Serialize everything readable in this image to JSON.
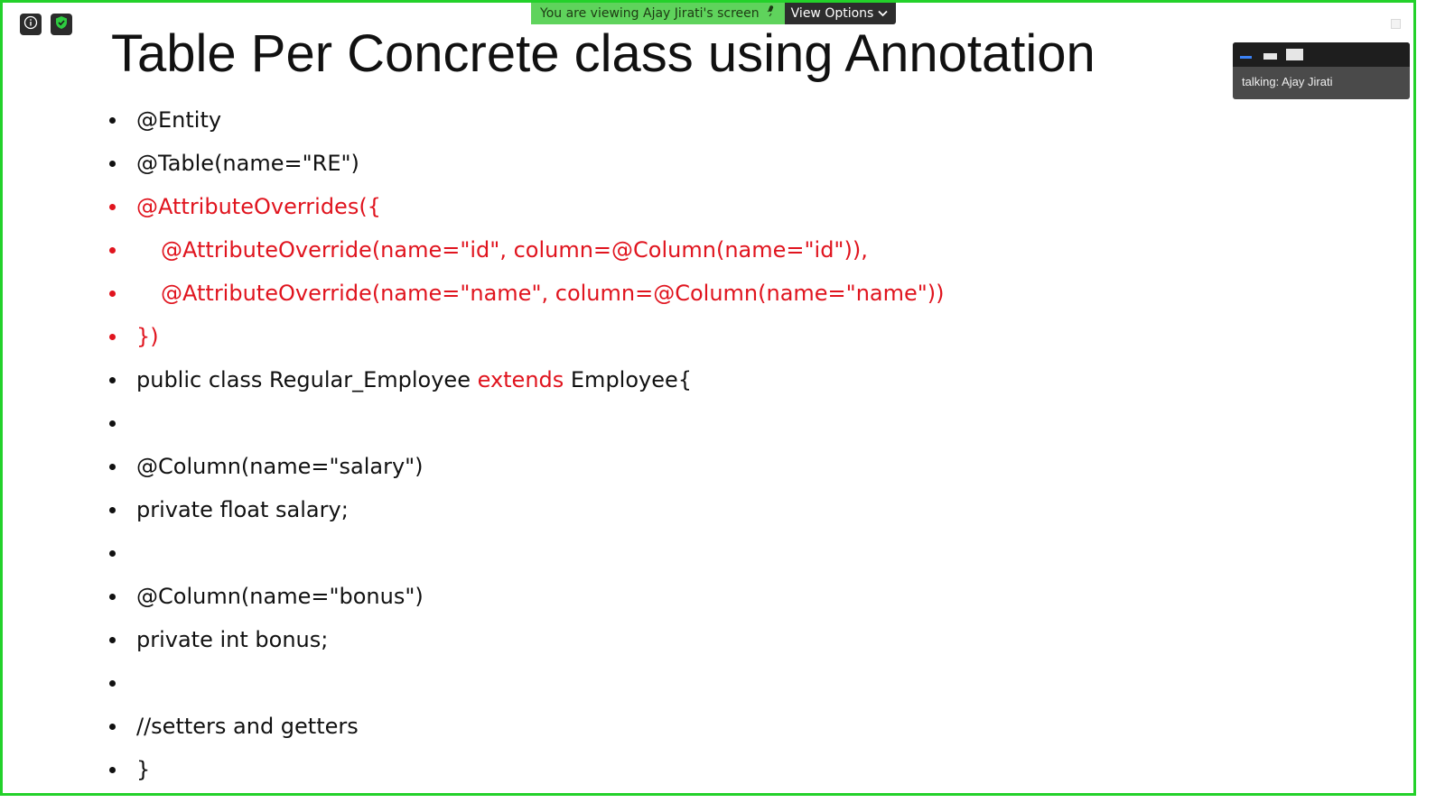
{
  "app": {
    "share_banner": {
      "text": "You are viewing Ajay Jirati's screen",
      "view_options_label": "View Options"
    },
    "talking_panel": {
      "label": "talking:",
      "speaker": "Ajay Jirati"
    },
    "colors": {
      "frame_border": "#23d12a",
      "banner_green": "#5fd35c",
      "code_red": "#e0141e",
      "accent_blue": "#3b82f6"
    },
    "icons": [
      "info-icon",
      "shield-check-icon",
      "microphone-icon",
      "chevron-down-icon"
    ]
  },
  "slide": {
    "title": "Table Per Concrete class using Annotation",
    "lines": [
      "@Entity",
      "@Table(name=\"RE\")",
      "@AttributeOverrides({",
      "@AttributeOverride(name=\"id\", column=@Column(name=\"id\")),",
      "@AttributeOverride(name=\"name\", column=@Column(name=\"name\"))",
      "})",
      "public class Regular_Employee ",
      "extends",
      " Employee{",
      "",
      "@Column(name=\"salary\")",
      "private float salary;",
      "",
      "@Column(name=\"bonus\")",
      "private int bonus;",
      "",
      "//setters and getters",
      "}"
    ]
  }
}
